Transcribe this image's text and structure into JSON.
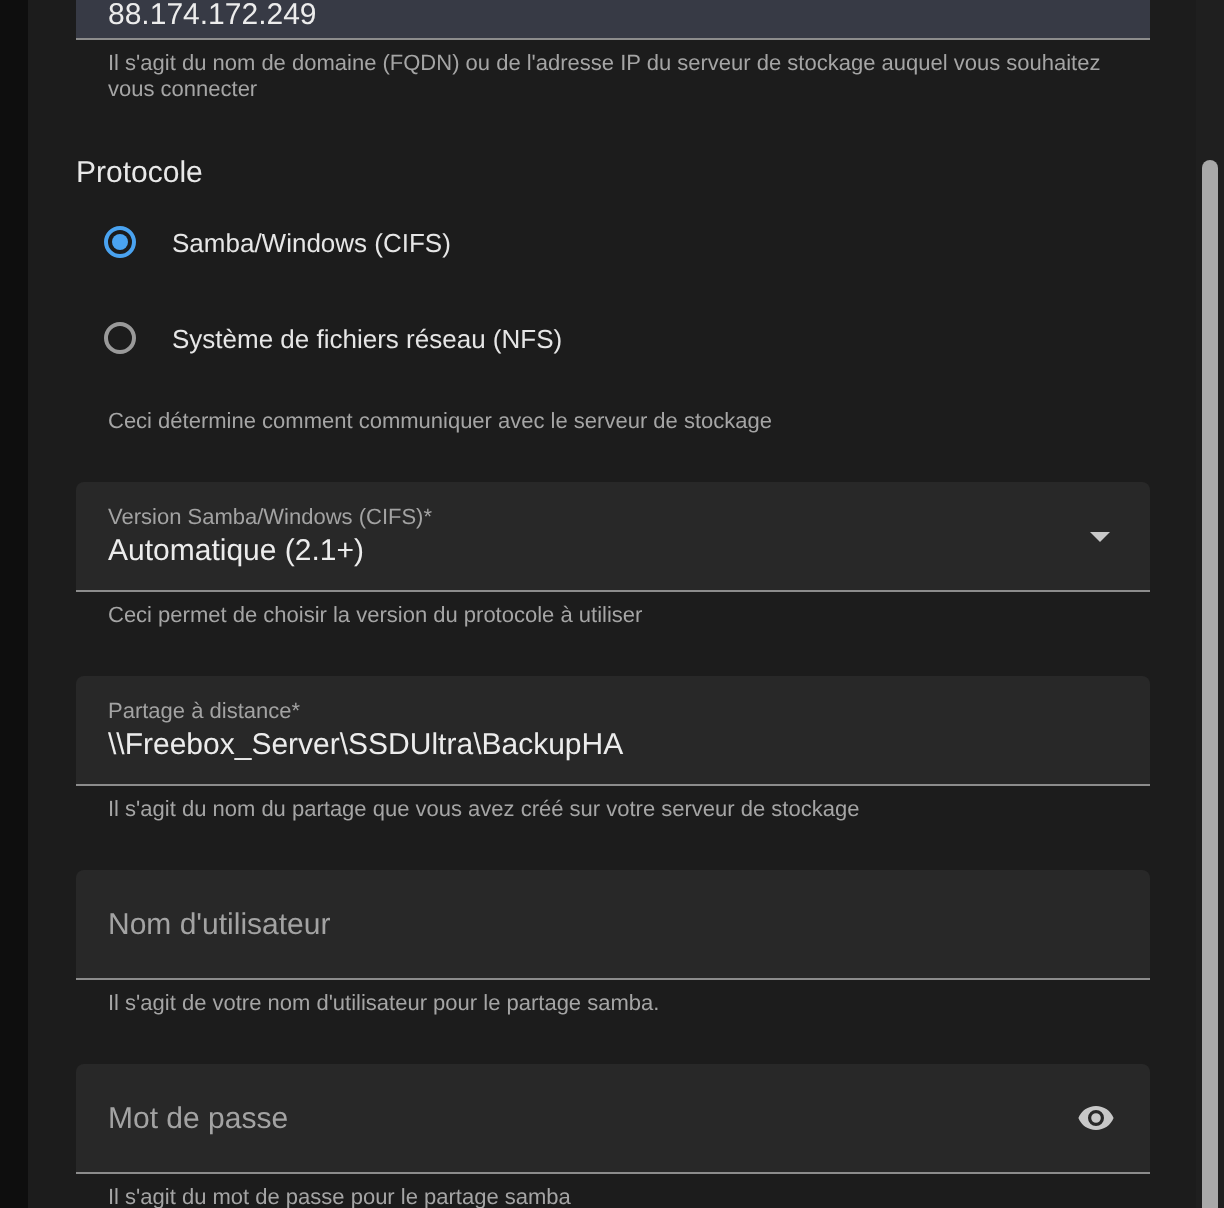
{
  "form": [
    {
      "kind": "text",
      "value": "88.174.172.249",
      "highlighted": true,
      "helper": "Il s'agit du nom de domaine (FQDN) ou de l'adresse IP du serveur de stockage auquel vous souhaitez vous connecter"
    },
    {
      "kind": "radio_group",
      "title": "Protocole",
      "options": [
        {
          "label": "Samba/Windows (CIFS)",
          "selected": true
        },
        {
          "label": "Système de fichiers réseau (NFS)",
          "selected": false
        }
      ],
      "helper": "Ceci détermine comment communiquer avec le serveur de stockage"
    },
    {
      "kind": "select",
      "label": "Version Samba/Windows (CIFS)*",
      "value": "Automatique (2.1+)",
      "helper": "Ceci permet de choisir la version du protocole à utiliser"
    },
    {
      "kind": "text",
      "label": "Partage à distance*",
      "value": "\\\\Freebox_Server\\SSDUltra\\BackupHA",
      "highlighted": false,
      "helper": "Il s'agit du nom du partage que vous avez créé sur votre serveur de stockage"
    },
    {
      "kind": "text",
      "placeholder": "Nom d'utilisateur",
      "highlighted": false,
      "helper": "Il s'agit de votre nom d'utilisateur pour le partage samba."
    },
    {
      "kind": "password",
      "placeholder": "Mot de passe",
      "highlighted": false,
      "helper": "Il s'agit du mot de passe pour le partage samba"
    }
  ]
}
